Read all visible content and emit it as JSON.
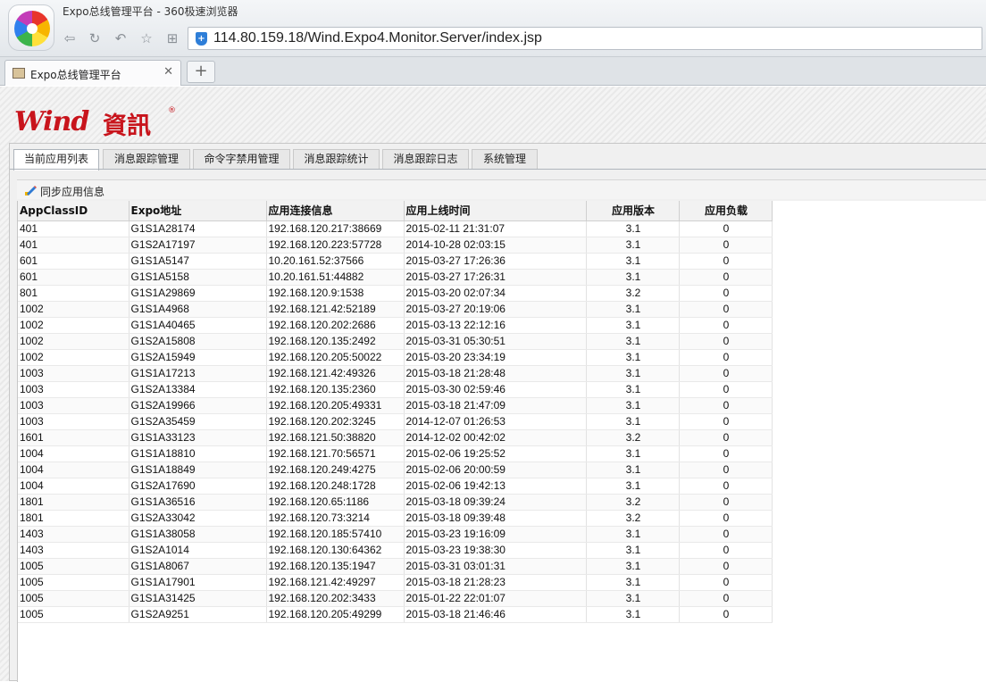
{
  "browser": {
    "window_title": "Expo总线管理平台 - 360极速浏览器",
    "url": "114.80.159.18/Wind.Expo4.Monitor.Server/index.jsp",
    "tab_title": "Expo总线管理平台",
    "nav_icons": [
      "back-icon",
      "refresh-icon",
      "undo-icon",
      "favorite-star-icon",
      "apps-grid-icon"
    ]
  },
  "brand": {
    "logo_en": "Wind",
    "logo_cn": "資訊",
    "logo_reg": "®",
    "color": "#c8141c"
  },
  "tabs": [
    {
      "label": "当前应用列表",
      "active": true
    },
    {
      "label": "消息跟踪管理",
      "active": false
    },
    {
      "label": "命令字禁用管理",
      "active": false
    },
    {
      "label": "消息跟踪统计",
      "active": false
    },
    {
      "label": "消息跟踪日志",
      "active": false
    },
    {
      "label": "系统管理",
      "active": false
    }
  ],
  "toolbar": {
    "sync_label": "同步应用信息",
    "sync_icon": "edit-pencil-icon"
  },
  "grid": {
    "columns": [
      "AppClassID",
      "Expo地址",
      "应用连接信息",
      "应用上线时间",
      "应用版本",
      "应用负载"
    ],
    "rows": [
      [
        "401",
        "G1S1A28174",
        "192.168.120.217:38669",
        "2015-02-11 21:31:07",
        "3.1",
        "0"
      ],
      [
        "401",
        "G1S2A17197",
        "192.168.120.223:57728",
        "2014-10-28 02:03:15",
        "3.1",
        "0"
      ],
      [
        "601",
        "G1S1A5147",
        "10.20.161.52:37566",
        "2015-03-27 17:26:36",
        "3.1",
        "0"
      ],
      [
        "601",
        "G1S1A5158",
        "10.20.161.51:44882",
        "2015-03-27 17:26:31",
        "3.1",
        "0"
      ],
      [
        "801",
        "G1S1A29869",
        "192.168.120.9:1538",
        "2015-03-20 02:07:34",
        "3.2",
        "0"
      ],
      [
        "1002",
        "G1S1A4968",
        "192.168.121.42:52189",
        "2015-03-27 20:19:06",
        "3.1",
        "0"
      ],
      [
        "1002",
        "G1S1A40465",
        "192.168.120.202:2686",
        "2015-03-13 22:12:16",
        "3.1",
        "0"
      ],
      [
        "1002",
        "G1S2A15808",
        "192.168.120.135:2492",
        "2015-03-31 05:30:51",
        "3.1",
        "0"
      ],
      [
        "1002",
        "G1S2A15949",
        "192.168.120.205:50022",
        "2015-03-20 23:34:19",
        "3.1",
        "0"
      ],
      [
        "1003",
        "G1S1A17213",
        "192.168.121.42:49326",
        "2015-03-18 21:28:48",
        "3.1",
        "0"
      ],
      [
        "1003",
        "G1S2A13384",
        "192.168.120.135:2360",
        "2015-03-30 02:59:46",
        "3.1",
        "0"
      ],
      [
        "1003",
        "G1S2A19966",
        "192.168.120.205:49331",
        "2015-03-18 21:47:09",
        "3.1",
        "0"
      ],
      [
        "1003",
        "G1S2A35459",
        "192.168.120.202:3245",
        "2014-12-07 01:26:53",
        "3.1",
        "0"
      ],
      [
        "1601",
        "G1S1A33123",
        "192.168.121.50:38820",
        "2014-12-02 00:42:02",
        "3.2",
        "0"
      ],
      [
        "1004",
        "G1S1A18810",
        "192.168.121.70:56571",
        "2015-02-06 19:25:52",
        "3.1",
        "0"
      ],
      [
        "1004",
        "G1S1A18849",
        "192.168.120.249:4275",
        "2015-02-06 20:00:59",
        "3.1",
        "0"
      ],
      [
        "1004",
        "G1S2A17690",
        "192.168.120.248:1728",
        "2015-02-06 19:42:13",
        "3.1",
        "0"
      ],
      [
        "1801",
        "G1S1A36516",
        "192.168.120.65:1186",
        "2015-03-18 09:39:24",
        "3.2",
        "0"
      ],
      [
        "1801",
        "G1S2A33042",
        "192.168.120.73:3214",
        "2015-03-18 09:39:48",
        "3.2",
        "0"
      ],
      [
        "1403",
        "G1S1A38058",
        "192.168.120.185:57410",
        "2015-03-23 19:16:09",
        "3.1",
        "0"
      ],
      [
        "1403",
        "G1S2A1014",
        "192.168.120.130:64362",
        "2015-03-23 19:38:30",
        "3.1",
        "0"
      ],
      [
        "1005",
        "G1S1A8067",
        "192.168.120.135:1947",
        "2015-03-31 03:01:31",
        "3.1",
        "0"
      ],
      [
        "1005",
        "G1S1A17901",
        "192.168.121.42:49297",
        "2015-03-18 21:28:23",
        "3.1",
        "0"
      ],
      [
        "1005",
        "G1S1A31425",
        "192.168.120.202:3433",
        "2015-01-22 22:01:07",
        "3.1",
        "0"
      ],
      [
        "1005",
        "G1S2A9251",
        "192.168.120.205:49299",
        "2015-03-18 21:46:46",
        "3.1",
        "0"
      ]
    ]
  }
}
